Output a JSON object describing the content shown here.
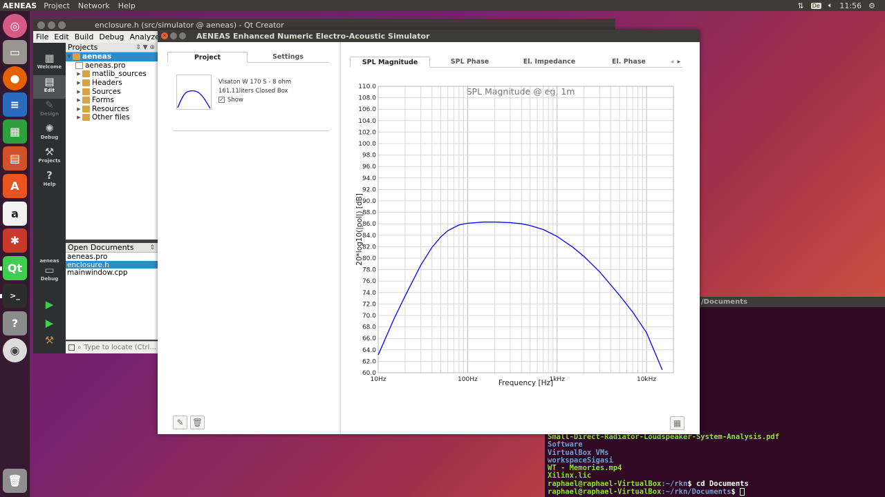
{
  "top_panel": {
    "app_name": "AENEAS",
    "menu": [
      "Project",
      "Network",
      "Help"
    ],
    "keyboard_layout": "De",
    "clock": "11:56"
  },
  "launcher": {
    "items": [
      "ubuntu-dash",
      "files",
      "firefox",
      "libreoffice-writer",
      "libreoffice-calc",
      "libreoffice-impress",
      "software-center",
      "amazon",
      "system-settings",
      "qt-creator",
      "terminal",
      "help",
      "dvd",
      "trash"
    ]
  },
  "qt_creator": {
    "title": "enclosure.h (src/simulator @ aeneas) - Qt Creator",
    "menu": [
      "File",
      "Edit",
      "Build",
      "Debug",
      "Analyze"
    ],
    "modes": [
      {
        "label": "Welcome",
        "icon": "grid-icon"
      },
      {
        "label": "Edit",
        "icon": "edit-icon"
      },
      {
        "label": "Design",
        "icon": "pencil-icon"
      },
      {
        "label": "Debug",
        "icon": "bug-icon"
      },
      {
        "label": "Projects",
        "icon": "wrench-icon"
      },
      {
        "label": "Help",
        "icon": "help-icon"
      }
    ],
    "kit": {
      "project": "aeneas",
      "config": "Debug"
    },
    "projects_header": "Projects",
    "tree": [
      {
        "label": "aeneas",
        "kind": "project"
      },
      {
        "label": "aeneas.pro",
        "kind": "file"
      },
      {
        "label": "matlib_sources",
        "kind": "folder"
      },
      {
        "label": "Headers",
        "kind": "folder"
      },
      {
        "label": "Sources",
        "kind": "folder"
      },
      {
        "label": "Forms",
        "kind": "folder"
      },
      {
        "label": "Resources",
        "kind": "folder"
      },
      {
        "label": "Other files",
        "kind": "folder"
      }
    ],
    "open_documents_header": "Open Documents",
    "open_documents": [
      "aeneas.pro",
      "enclosure.h",
      "mainwindow.cpp"
    ],
    "locator_placeholder": "Type to locate (Ctrl..."
  },
  "terminal": {
    "title_fragment": "/Documents",
    "lines": [
      {
        "text": "Small-Direct-Radiator-Loudspeaker-System-Analysis.pdf",
        "kind": "exe"
      },
      {
        "text": "Software",
        "kind": "dir"
      },
      {
        "text": "VirtualBox VMs",
        "kind": "dir"
      },
      {
        "text": "workspaceSigasi",
        "kind": "dir"
      },
      {
        "text": "WT - Memories.mp4",
        "kind": "exe"
      },
      {
        "text": "Xilinx.lic",
        "kind": "exe"
      }
    ],
    "prompt1_user": "raphael@raphael-VirtualBox",
    "prompt1_path": ":~/rkn",
    "prompt1_cmd": "$ cd Documents",
    "prompt2_user": "raphael@raphael-VirtualBox",
    "prompt2_path": ":~/rkn/Documents",
    "prompt2_cmd": "$ "
  },
  "aeneas": {
    "title": "AENEAS Enhanced Numeric Electro-Acoustic Simulator",
    "left_tabs": [
      "Project",
      "Settings"
    ],
    "speaker": {
      "name": "Visaton W 170 S - 8 ohm",
      "enclosure": "161.11liters Closed Box",
      "show_label": "Show",
      "show_checked": true
    },
    "right_tabs": [
      "SPL Magnitude",
      "SPL Phase",
      "El. Impedance",
      "El. Phase"
    ],
    "active_right_tab": "SPL Magnitude"
  },
  "chart_data": {
    "type": "line",
    "title": "SPL Magnitude @ eg, 1m",
    "xlabel": "Frequency [Hz]",
    "ylabel": "20*log10(|pol|) [dB]",
    "xscale": "log",
    "xlim": [
      10,
      20000
    ],
    "ylim": [
      60,
      110
    ],
    "x_tick_labels": [
      "10Hz",
      "100Hz",
      "1kHz",
      "10kHz"
    ],
    "y_ticks": [
      60.0,
      62.0,
      64.0,
      66.0,
      68.0,
      70.0,
      72.0,
      74.0,
      76.0,
      78.0,
      80.0,
      82.0,
      84.0,
      86.0,
      88.0,
      90.0,
      92.0,
      94.0,
      96.0,
      98.0,
      100.0,
      102.0,
      104.0,
      106.0,
      108.0,
      110.0
    ],
    "grid": true,
    "color": "#0000ff",
    "series": [
      {
        "x": [
          10,
          15,
          20,
          30,
          40,
          50,
          60,
          80,
          100,
          150,
          200,
          300,
          400,
          500,
          700,
          1000,
          1500,
          2000,
          3000,
          5000,
          7000,
          10000,
          15000
        ],
        "values": [
          63.1,
          69.4,
          73.4,
          78.8,
          81.9,
          83.7,
          84.8,
          85.8,
          86.1,
          86.3,
          86.3,
          86.2,
          86.0,
          85.7,
          85.0,
          83.8,
          81.9,
          80.3,
          77.6,
          73.5,
          70.6,
          67.0,
          60.5
        ]
      }
    ]
  }
}
